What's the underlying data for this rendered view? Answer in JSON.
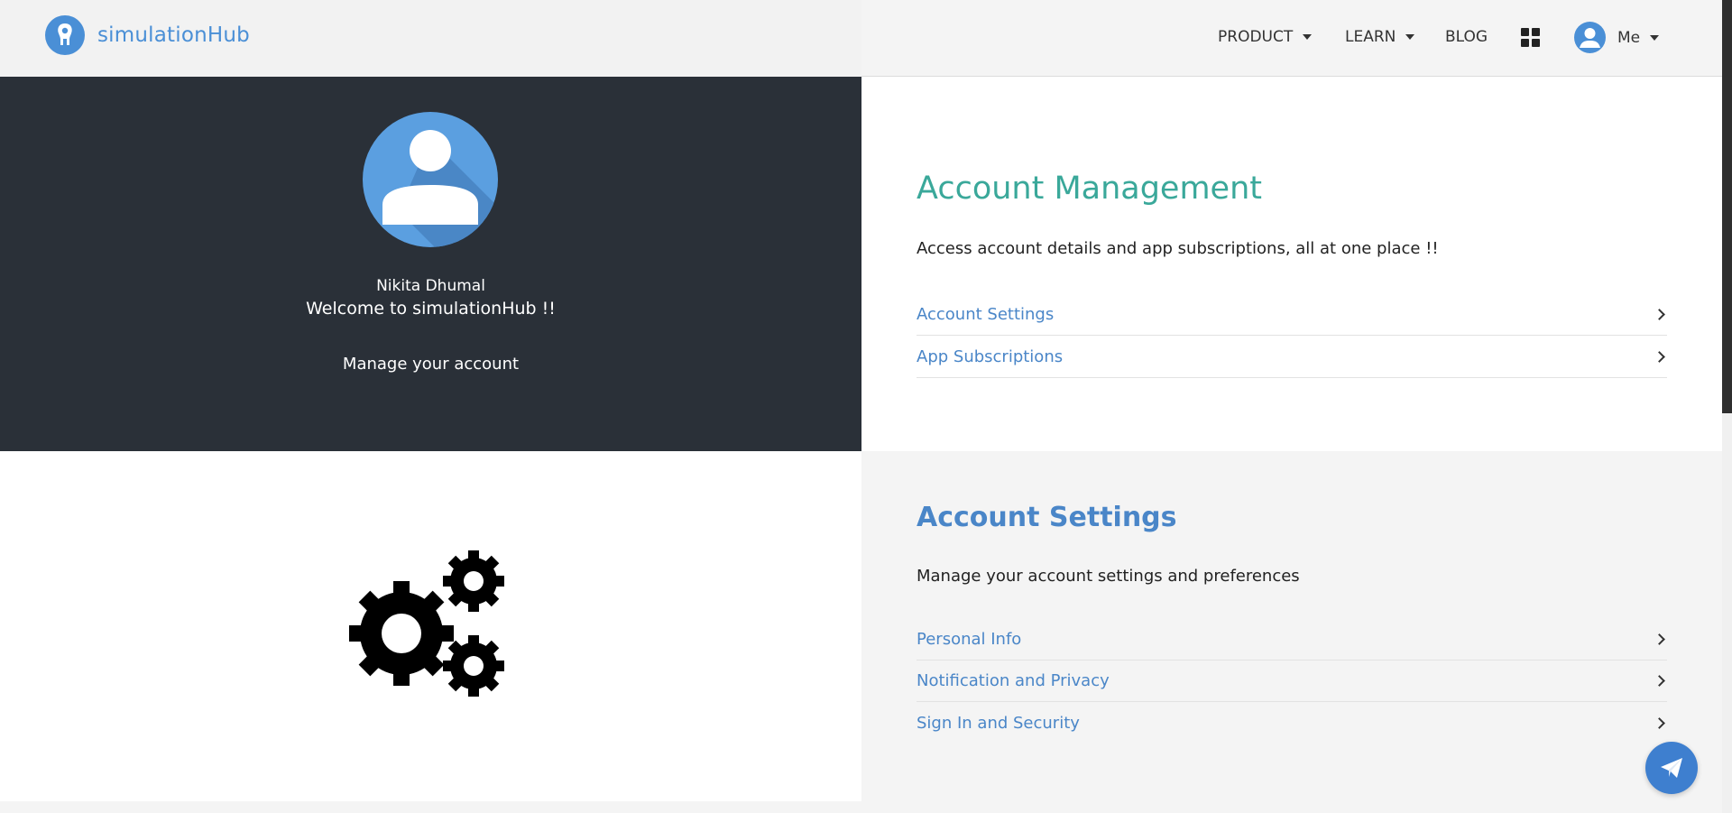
{
  "app": {
    "brand": "simulationHub"
  },
  "nav": {
    "product": "PRODUCT",
    "learn": "LEARN",
    "blog": "BLOG",
    "apps_icon": "grid-icon",
    "me": "Me"
  },
  "profile": {
    "name": "Nikita Dhumal",
    "welcome": "Welcome to simulationHub !!",
    "manage": "Manage your account"
  },
  "account_management": {
    "title": "Account Management",
    "description": "Access account details and app subscriptions, all at one place !!",
    "links": [
      {
        "label": "Account Settings"
      },
      {
        "label": "App Subscriptions"
      }
    ]
  },
  "account_settings": {
    "title": "Account Settings",
    "description": "Manage your account settings and preferences",
    "links": [
      {
        "label": "Personal Info"
      },
      {
        "label": "Notification and Privacy"
      },
      {
        "label": "Sign In and Security"
      }
    ]
  },
  "colors": {
    "brand_blue": "#4a8fd6",
    "teal_title": "#3aa89a",
    "dark_panel": "#2a3038",
    "active_underline": "#e8c93e"
  },
  "icons": {
    "logo": "simulationhub-logo-icon",
    "avatar": "user-avatar-icon",
    "settings": "gears-icon",
    "fab": "paper-plane-icon",
    "chevron": "chevron-right-icon"
  }
}
